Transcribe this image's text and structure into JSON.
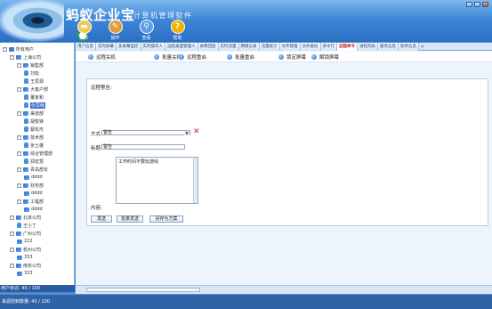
{
  "app": {
    "name": "蚂蚁企业宝",
    "subtitle": "计算机管理软件"
  },
  "ribbon": [
    {
      "label": "文件",
      "icon": "folder-icon",
      "color": "#f2c94c"
    },
    {
      "label": "操作",
      "icon": "tools-icon",
      "color": "#e39a3b"
    },
    {
      "label": "查看",
      "icon": "magnifier-icon",
      "color": "#5aa0e8"
    },
    {
      "label": "帮助",
      "icon": "help-icon",
      "color": "#f2b100"
    }
  ],
  "tree": {
    "items": [
      {
        "label": "所有用户",
        "type": "root",
        "expander": "-"
      },
      {
        "label": "上海公司",
        "type": "dept",
        "expander": "-"
      },
      {
        "label": "销售部",
        "type": "dept",
        "expander": "-"
      },
      {
        "label": "刘松",
        "type": "user"
      },
      {
        "label": "王思源",
        "type": "user"
      },
      {
        "label": "大客户部",
        "type": "dept",
        "expander": "-"
      },
      {
        "label": "董家和",
        "type": "user"
      },
      {
        "label": "张思翰",
        "type": "user",
        "selected": true
      },
      {
        "label": "渠道部",
        "type": "dept",
        "expander": "-"
      },
      {
        "label": "胡俊锋",
        "type": "user"
      },
      {
        "label": "蔡松杰",
        "type": "user"
      },
      {
        "label": "技术部",
        "type": "dept",
        "expander": "-"
      },
      {
        "label": "张士雄",
        "type": "user"
      },
      {
        "label": "综合管理部",
        "type": "dept",
        "expander": "-"
      },
      {
        "label": "郑宏慧",
        "type": "user"
      },
      {
        "label": "青岛部长",
        "type": "dept",
        "expander": "-"
      },
      {
        "label": "dddd",
        "type": "dept"
      },
      {
        "label": "财务部",
        "type": "dept",
        "expander": "-"
      },
      {
        "label": "dddd",
        "type": "dept"
      },
      {
        "label": "工程部",
        "type": "dept",
        "expander": "-"
      },
      {
        "label": "dddd",
        "type": "dept"
      },
      {
        "label": "北京公司",
        "type": "dept",
        "expander": "-"
      },
      {
        "label": "王小丁",
        "type": "user"
      },
      {
        "label": "广州公司",
        "type": "dept",
        "expander": "-"
      },
      {
        "label": "222",
        "type": "dept"
      },
      {
        "label": "杭州公司",
        "type": "dept",
        "expander": "-"
      },
      {
        "label": "333",
        "type": "dept"
      },
      {
        "label": "南京公司",
        "type": "dept",
        "expander": "-"
      },
      {
        "label": "333",
        "type": "dept"
      }
    ],
    "status": "用户标识: 40 / 100"
  },
  "tabs": [
    {
      "label": "用户信息"
    },
    {
      "label": "实时屏幕"
    },
    {
      "label": "多屏幕监控"
    },
    {
      "label": "实时操作人"
    },
    {
      "label": "远程桌面管理人"
    },
    {
      "label": "录像回放"
    },
    {
      "label": "实时流量"
    },
    {
      "label": "网络记录"
    },
    {
      "label": "流量统计"
    },
    {
      "label": "文件管理"
    },
    {
      "label": "文件备份"
    },
    {
      "label": "命令行"
    },
    {
      "label": "远程命令",
      "active": true
    },
    {
      "label": "进程列表"
    },
    {
      "label": "服务信息"
    },
    {
      "label": "软件信息"
    }
  ],
  "functions": [
    {
      "label": "远程关机"
    },
    {
      "label": "批量关机"
    },
    {
      "label": "远程重启"
    },
    {
      "label": "批量重启"
    },
    {
      "label": "锁定屏幕"
    },
    {
      "label": "解锁屏幕"
    }
  ],
  "form": {
    "section_title": "远程警告:",
    "method_label": "方式:",
    "method_value": "警告",
    "title_label": "标题:",
    "title_value": "警告",
    "content_label": "内容:",
    "content_value": "工作时间不要玩游戏",
    "buttons": [
      "发送",
      "批量发送",
      "另存为方案"
    ]
  },
  "statusbar": {
    "text": "来源控制数量: 40 / 100"
  },
  "colors": {
    "accent": "#3168c8",
    "active_tab_text": "#c01a1a",
    "delete_red": "#d21d1d"
  }
}
